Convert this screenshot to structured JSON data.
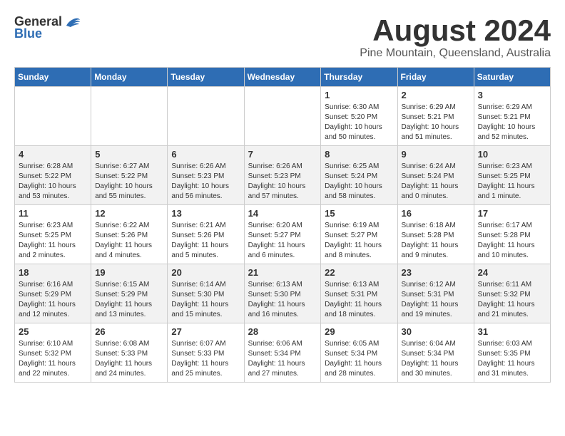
{
  "logo": {
    "general": "General",
    "blue": "Blue"
  },
  "title": "August 2024",
  "location": "Pine Mountain, Queensland, Australia",
  "days_header": [
    "Sunday",
    "Monday",
    "Tuesday",
    "Wednesday",
    "Thursday",
    "Friday",
    "Saturday"
  ],
  "weeks": [
    [
      {
        "num": "",
        "info": ""
      },
      {
        "num": "",
        "info": ""
      },
      {
        "num": "",
        "info": ""
      },
      {
        "num": "",
        "info": ""
      },
      {
        "num": "1",
        "info": "Sunrise: 6:30 AM\nSunset: 5:20 PM\nDaylight: 10 hours\nand 50 minutes."
      },
      {
        "num": "2",
        "info": "Sunrise: 6:29 AM\nSunset: 5:21 PM\nDaylight: 10 hours\nand 51 minutes."
      },
      {
        "num": "3",
        "info": "Sunrise: 6:29 AM\nSunset: 5:21 PM\nDaylight: 10 hours\nand 52 minutes."
      }
    ],
    [
      {
        "num": "4",
        "info": "Sunrise: 6:28 AM\nSunset: 5:22 PM\nDaylight: 10 hours\nand 53 minutes."
      },
      {
        "num": "5",
        "info": "Sunrise: 6:27 AM\nSunset: 5:22 PM\nDaylight: 10 hours\nand 55 minutes."
      },
      {
        "num": "6",
        "info": "Sunrise: 6:26 AM\nSunset: 5:23 PM\nDaylight: 10 hours\nand 56 minutes."
      },
      {
        "num": "7",
        "info": "Sunrise: 6:26 AM\nSunset: 5:23 PM\nDaylight: 10 hours\nand 57 minutes."
      },
      {
        "num": "8",
        "info": "Sunrise: 6:25 AM\nSunset: 5:24 PM\nDaylight: 10 hours\nand 58 minutes."
      },
      {
        "num": "9",
        "info": "Sunrise: 6:24 AM\nSunset: 5:24 PM\nDaylight: 11 hours\nand 0 minutes."
      },
      {
        "num": "10",
        "info": "Sunrise: 6:23 AM\nSunset: 5:25 PM\nDaylight: 11 hours\nand 1 minute."
      }
    ],
    [
      {
        "num": "11",
        "info": "Sunrise: 6:23 AM\nSunset: 5:25 PM\nDaylight: 11 hours\nand 2 minutes."
      },
      {
        "num": "12",
        "info": "Sunrise: 6:22 AM\nSunset: 5:26 PM\nDaylight: 11 hours\nand 4 minutes."
      },
      {
        "num": "13",
        "info": "Sunrise: 6:21 AM\nSunset: 5:26 PM\nDaylight: 11 hours\nand 5 minutes."
      },
      {
        "num": "14",
        "info": "Sunrise: 6:20 AM\nSunset: 5:27 PM\nDaylight: 11 hours\nand 6 minutes."
      },
      {
        "num": "15",
        "info": "Sunrise: 6:19 AM\nSunset: 5:27 PM\nDaylight: 11 hours\nand 8 minutes."
      },
      {
        "num": "16",
        "info": "Sunrise: 6:18 AM\nSunset: 5:28 PM\nDaylight: 11 hours\nand 9 minutes."
      },
      {
        "num": "17",
        "info": "Sunrise: 6:17 AM\nSunset: 5:28 PM\nDaylight: 11 hours\nand 10 minutes."
      }
    ],
    [
      {
        "num": "18",
        "info": "Sunrise: 6:16 AM\nSunset: 5:29 PM\nDaylight: 11 hours\nand 12 minutes."
      },
      {
        "num": "19",
        "info": "Sunrise: 6:15 AM\nSunset: 5:29 PM\nDaylight: 11 hours\nand 13 minutes."
      },
      {
        "num": "20",
        "info": "Sunrise: 6:14 AM\nSunset: 5:30 PM\nDaylight: 11 hours\nand 15 minutes."
      },
      {
        "num": "21",
        "info": "Sunrise: 6:13 AM\nSunset: 5:30 PM\nDaylight: 11 hours\nand 16 minutes."
      },
      {
        "num": "22",
        "info": "Sunrise: 6:13 AM\nSunset: 5:31 PM\nDaylight: 11 hours\nand 18 minutes."
      },
      {
        "num": "23",
        "info": "Sunrise: 6:12 AM\nSunset: 5:31 PM\nDaylight: 11 hours\nand 19 minutes."
      },
      {
        "num": "24",
        "info": "Sunrise: 6:11 AM\nSunset: 5:32 PM\nDaylight: 11 hours\nand 21 minutes."
      }
    ],
    [
      {
        "num": "25",
        "info": "Sunrise: 6:10 AM\nSunset: 5:32 PM\nDaylight: 11 hours\nand 22 minutes."
      },
      {
        "num": "26",
        "info": "Sunrise: 6:08 AM\nSunset: 5:33 PM\nDaylight: 11 hours\nand 24 minutes."
      },
      {
        "num": "27",
        "info": "Sunrise: 6:07 AM\nSunset: 5:33 PM\nDaylight: 11 hours\nand 25 minutes."
      },
      {
        "num": "28",
        "info": "Sunrise: 6:06 AM\nSunset: 5:34 PM\nDaylight: 11 hours\nand 27 minutes."
      },
      {
        "num": "29",
        "info": "Sunrise: 6:05 AM\nSunset: 5:34 PM\nDaylight: 11 hours\nand 28 minutes."
      },
      {
        "num": "30",
        "info": "Sunrise: 6:04 AM\nSunset: 5:34 PM\nDaylight: 11 hours\nand 30 minutes."
      },
      {
        "num": "31",
        "info": "Sunrise: 6:03 AM\nSunset: 5:35 PM\nDaylight: 11 hours\nand 31 minutes."
      }
    ]
  ]
}
